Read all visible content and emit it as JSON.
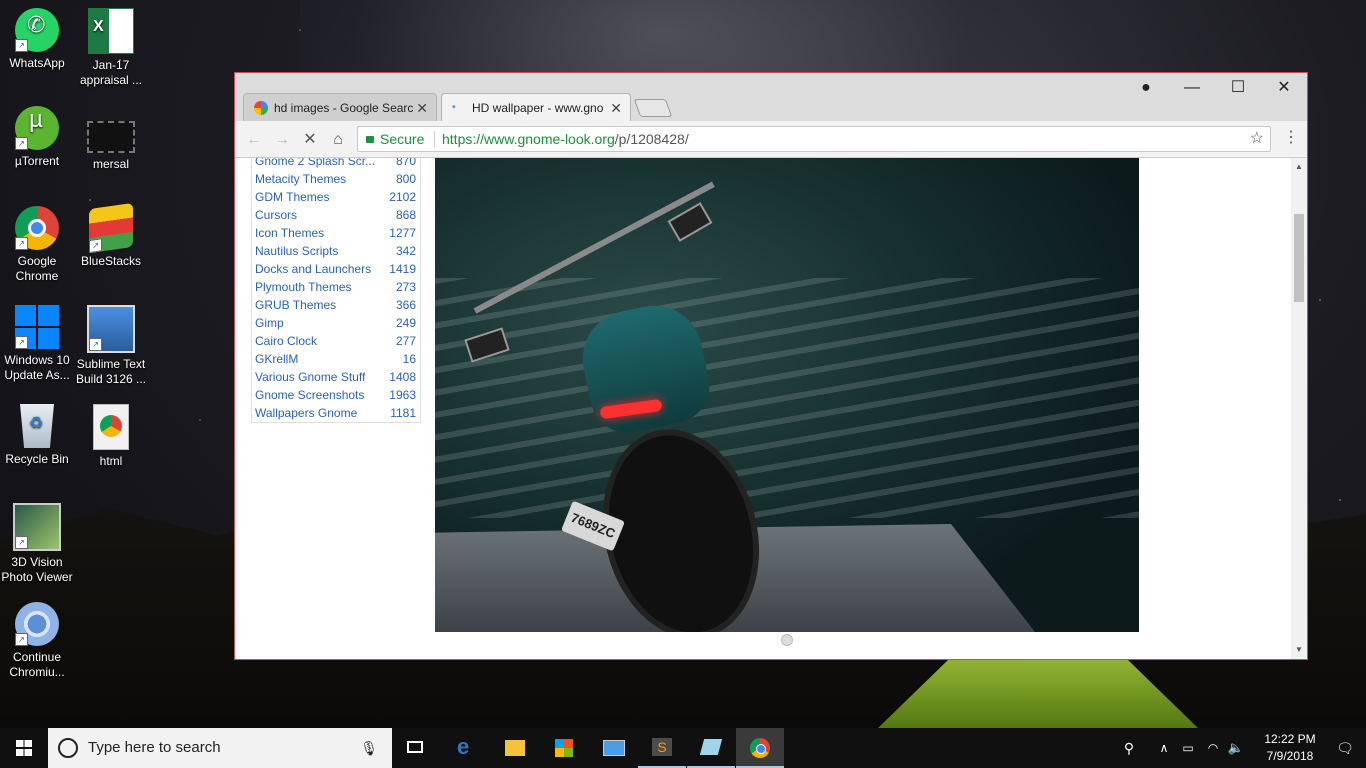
{
  "desktop": {
    "icons": [
      {
        "label": "WhatsApp",
        "icon": "whatsapp-icon"
      },
      {
        "label": "Jan-17 appraisal ...",
        "icon": "excel-icon"
      },
      {
        "label": "µTorrent",
        "icon": "utorrent-icon"
      },
      {
        "label": "mersal",
        "icon": "video-file-icon"
      },
      {
        "label": "Google Chrome",
        "icon": "chrome-icon"
      },
      {
        "label": "BlueStacks",
        "icon": "bluestacks-icon"
      },
      {
        "label": "Windows 10 Update As...",
        "icon": "windows-icon"
      },
      {
        "label": "Sublime Text Build 3126 ...",
        "icon": "installer-icon"
      },
      {
        "label": "Recycle Bin",
        "icon": "recycle-bin-icon"
      },
      {
        "label": "html",
        "icon": "html-file-icon"
      },
      {
        "label": "3D Vision Photo Viewer",
        "icon": "3d-vision-icon"
      },
      {
        "label": "Continue Chromiu...",
        "icon": "chromium-icon"
      }
    ]
  },
  "browser": {
    "tabs": [
      {
        "title": "hd images - Google Searc",
        "active": false
      },
      {
        "title": "HD wallpaper - www.gno",
        "active": true
      }
    ],
    "address": {
      "secure_label": "Secure",
      "url_host": "https://www.gnome-look.org",
      "url_path": "/p/1208428/"
    },
    "categories": [
      {
        "name": "Gnome 2 Splash Scr...",
        "count": "870"
      },
      {
        "name": "Metacity Themes",
        "count": "800"
      },
      {
        "name": "GDM Themes",
        "count": "2102"
      },
      {
        "name": "Cursors",
        "count": "868"
      },
      {
        "name": "Icon Themes",
        "count": "1277"
      },
      {
        "name": "Nautilus Scripts",
        "count": "342"
      },
      {
        "name": "Docks and Launchers",
        "count": "1419"
      },
      {
        "name": "Plymouth Themes",
        "count": "273"
      },
      {
        "name": "GRUB Themes",
        "count": "366"
      },
      {
        "name": "Gimp",
        "count": "249"
      },
      {
        "name": "Cairo Clock",
        "count": "277"
      },
      {
        "name": "GKrellM",
        "count": "16"
      },
      {
        "name": "Various Gnome Stuff",
        "count": "1408"
      },
      {
        "name": "Gnome Screenshots",
        "count": "1963"
      },
      {
        "name": "Wallpapers Gnome",
        "count": "1181"
      }
    ],
    "photo": {
      "plate_text": "7689ZC"
    }
  },
  "taskbar": {
    "search_placeholder": "Type here to search",
    "time": "12:22 PM",
    "date": "7/9/2018"
  },
  "colors": {
    "link": "#2b63b3",
    "secure": "#1e8e3e",
    "window_border": "#d14b55"
  }
}
